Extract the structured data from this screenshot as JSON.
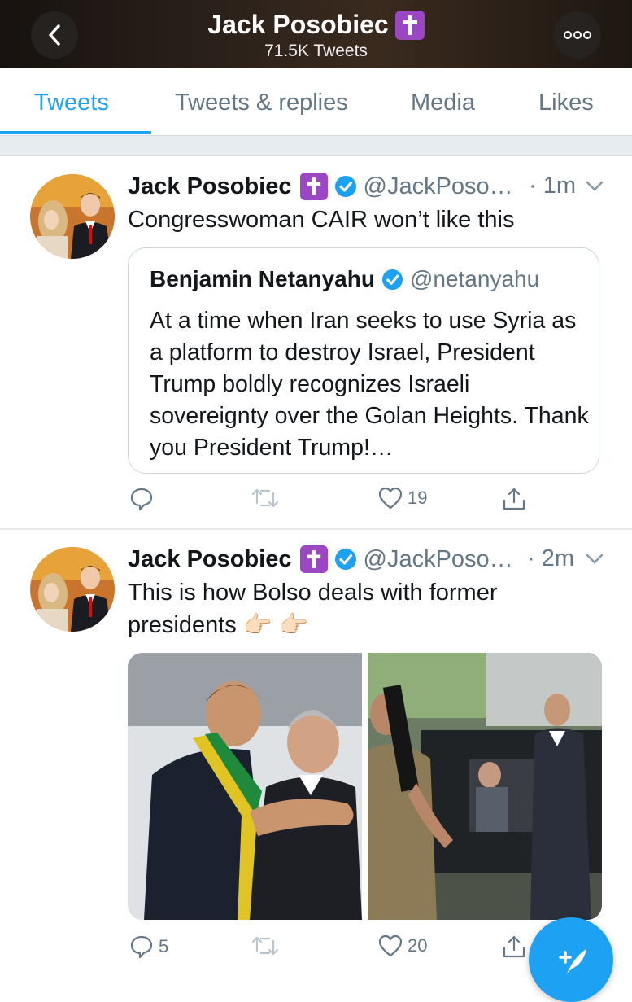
{
  "header": {
    "title": "Jack Posobiec",
    "subtitle": "71.5K Tweets"
  },
  "tabs": [
    {
      "label": "Tweets",
      "active": true
    },
    {
      "label": "Tweets & replies",
      "active": false
    },
    {
      "label": "Media",
      "active": false
    },
    {
      "label": "Likes",
      "active": false
    }
  ],
  "colors": {
    "accent": "#1da1f2",
    "badge": "#9b47c4",
    "muted": "#657786"
  },
  "tweets": [
    {
      "name": "Jack Posobiec",
      "handle": "@JackPoso…",
      "time": "· 1m",
      "text": "Congresswoman CAIR won’t like this",
      "quote": {
        "name": "Benjamin Netanyahu",
        "handle": "@netanyahu",
        "text": "At a time when Iran seeks to use Syria as a platform to destroy Israel, President Trump boldly recognizes Israeli sovereignty over the Golan Heights. Thank you President Trump!…"
      },
      "replies": "",
      "likes": "19"
    },
    {
      "name": "Jack Posobiec",
      "handle": "@JackPoso…",
      "time": "· 2m",
      "text": "This is how Bolso deals with former presidents 👉🏻 👉🏻",
      "replies": "5",
      "likes": "20"
    }
  ]
}
